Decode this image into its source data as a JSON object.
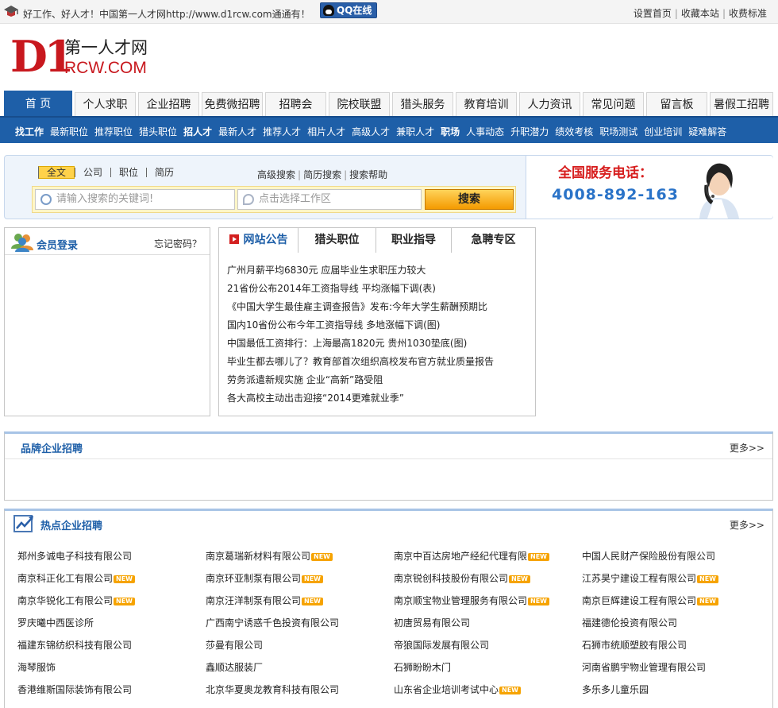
{
  "topbar": {
    "welcome": "好工作、好人才！中国第一人才网http://www.d1rcw.com通通有！",
    "qq_label": "QQ在线",
    "links": [
      "设置首页",
      "收藏本站",
      "收费标准"
    ]
  },
  "logo": {
    "mark": "D1",
    "cn": "第一人才网",
    "en": "RCW.COM"
  },
  "main_nav": [
    "首 页",
    "个人求职",
    "企业招聘",
    "免费微招聘",
    "招聘会",
    "院校联盟",
    "猎头服务",
    "教育培训",
    "人力资讯",
    "常见问题",
    "留言板",
    "暑假工招聘"
  ],
  "sub_nav": [
    {
      "label": "找工作",
      "bold": true
    },
    {
      "label": "最新职位",
      "bold": false
    },
    {
      "label": "推荐职位",
      "bold": false
    },
    {
      "label": "猎头职位",
      "bold": false
    },
    {
      "label": "招人才",
      "bold": true
    },
    {
      "label": "最新人才",
      "bold": false
    },
    {
      "label": "推荐人才",
      "bold": false
    },
    {
      "label": "相片人才",
      "bold": false
    },
    {
      "label": "高级人才",
      "bold": false
    },
    {
      "label": "兼职人才",
      "bold": false
    },
    {
      "label": "职场",
      "bold": true
    },
    {
      "label": "人事动态",
      "bold": false
    },
    {
      "label": "升职潜力",
      "bold": false
    },
    {
      "label": "绩效考核",
      "bold": false
    },
    {
      "label": "职场测试",
      "bold": false
    },
    {
      "label": "创业培训",
      "bold": false
    },
    {
      "label": "疑难解答",
      "bold": false
    }
  ],
  "search": {
    "tabs": [
      "全文",
      "公司",
      "职位",
      "简历"
    ],
    "active_tab": "全文",
    "links": [
      "高级搜索",
      "简历搜索",
      "搜索帮助"
    ],
    "keyword_placeholder": "请输入搜索的关键词!",
    "area_placeholder": "点击选择工作区",
    "button": "搜索",
    "hotline_title": "全国服务电话：",
    "hotline_number": "4008-892-163"
  },
  "login": {
    "title": "会员登录",
    "forgot": "忘记密码？"
  },
  "news": {
    "tabs": [
      "网站公告",
      "猎头职位",
      "职业指导",
      "急聘专区"
    ],
    "items": [
      "广州月薪平均6830元 应届毕业生求职压力较大",
      "21省份公布2014年工资指导线 平均涨幅下调(表)",
      "《中国大学生最佳雇主调查报告》发布:今年大学生薪酬预期比",
      "国内10省份公布今年工资指导线 多地涨幅下调(图)",
      "中国最低工资排行：上海最高1820元 贵州1030垫底(图)",
      "毕业生都去哪儿了？教育部首次组织高校发布官方就业质量报告",
      "劳务派遣新规实施 企业“高新”路受阻",
      "各大高校主动出击迎接“2014更难就业季”"
    ]
  },
  "brand": {
    "title": "品牌企业招聘",
    "more": "更多>>"
  },
  "hot": {
    "title": "热点企业招聘",
    "more": "更多>>",
    "new_badge": "NEW",
    "companies": [
      {
        "name": "郑州多诚电子科技有限公司",
        "new": false
      },
      {
        "name": "南京葛瑞新材料有限公司",
        "new": true
      },
      {
        "name": "南京中百达房地产经纪代理有限",
        "new": true
      },
      {
        "name": "中国人民财产保险股份有限公司",
        "new": false
      },
      {
        "name": "南京科正化工有限公司",
        "new": true
      },
      {
        "name": "南京环亚制泵有限公司",
        "new": true
      },
      {
        "name": "南京锐创科技股份有限公司",
        "new": true
      },
      {
        "name": "江苏昊宁建设工程有限公司",
        "new": true
      },
      {
        "name": "南京华锐化工有限公司",
        "new": true
      },
      {
        "name": "南京汪洋制泵有限公司",
        "new": true
      },
      {
        "name": "南京顺宝物业管理服务有限公司",
        "new": true
      },
      {
        "name": "南京巨辉建设工程有限公司",
        "new": true
      },
      {
        "name": "罗庆曦中西医诊所",
        "new": false
      },
      {
        "name": "广西南宁诱惑千色投资有限公司",
        "new": false
      },
      {
        "name": "初唐贸易有限公司",
        "new": false
      },
      {
        "name": "福建德伦投资有限公司",
        "new": false
      },
      {
        "name": "福建东锦纺织科技有限公司",
        "new": false
      },
      {
        "name": "莎曼有限公司",
        "new": false
      },
      {
        "name": "帝狼国际发展有限公司",
        "new": false
      },
      {
        "name": "石狮市统顺塑胶有限公司",
        "new": false
      },
      {
        "name": "海琴服饰",
        "new": false
      },
      {
        "name": "鑫顺达服装厂",
        "new": false
      },
      {
        "name": "石狮盼盼木门",
        "new": false
      },
      {
        "name": "河南省鹏宇物业管理有限公司",
        "new": false
      },
      {
        "name": "香港维斯国际装饰有限公司",
        "new": false
      },
      {
        "name": "北京华夏奥龙教育科技有限公司",
        "new": false
      },
      {
        "name": "山东省企业培训考试中心",
        "new": true
      },
      {
        "name": "多乐多儿童乐园",
        "new": false
      }
    ]
  },
  "colors": {
    "brand_blue": "#1e5fa8",
    "brand_red": "#c8181e",
    "phone_blue": "#2a73c8",
    "new_badge": "#f6a300"
  }
}
